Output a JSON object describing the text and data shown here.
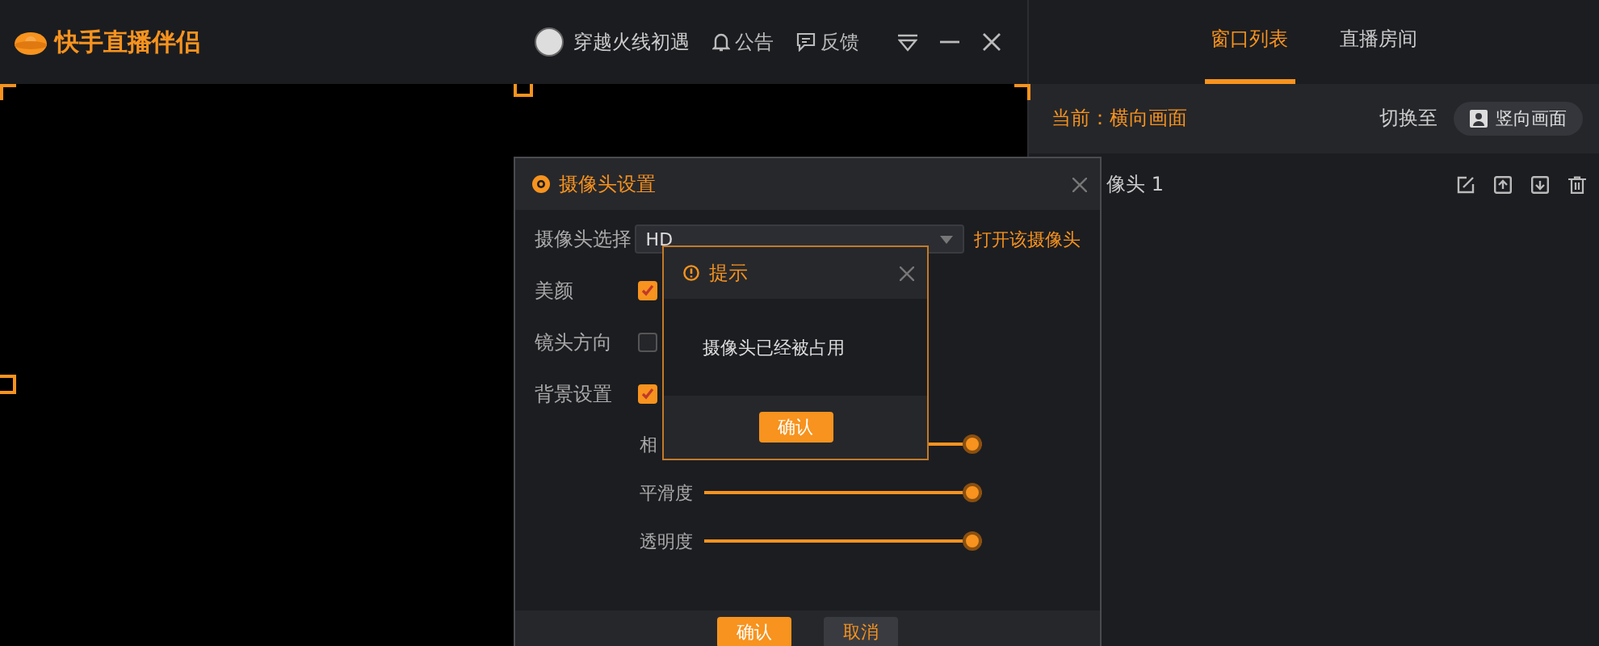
{
  "app": {
    "title": "快手直播伴侣"
  },
  "user": {
    "name": "穿越火线初遇"
  },
  "top_actions": [
    {
      "kind": "notice",
      "label": "公告"
    },
    {
      "kind": "feedback",
      "label": "反馈"
    }
  ],
  "right_panel": {
    "tabs": [
      {
        "label": "窗口列表",
        "selected": true
      },
      {
        "label": "直播房间",
        "selected": false
      }
    ],
    "current": "当前：横向画面",
    "switch_label": "切换至",
    "switch_button": "竖向画面",
    "sources": [
      {
        "name": "像头 1"
      }
    ]
  },
  "camera_dialog": {
    "title": "摄像头设置",
    "rows": [
      {
        "kind": "select",
        "label": "摄像头选择",
        "value": "HD",
        "link": "打开该摄像头"
      },
      {
        "kind": "checkbox",
        "label": "美颜",
        "checked": true
      },
      {
        "kind": "checkbox",
        "label": "镜头方向",
        "checked": false
      },
      {
        "kind": "checkbox",
        "label": "背景设置",
        "checked": true
      }
    ],
    "sliders": [
      {
        "label": "相",
        "level": 1
      },
      {
        "label": "平滑度",
        "level": 1
      },
      {
        "label": "透明度",
        "level": 1
      }
    ],
    "buttons": [
      {
        "kind": "primary",
        "label": "确认"
      },
      {
        "kind": "secondary",
        "label": "取消"
      }
    ]
  },
  "alert": {
    "title": "提示",
    "message": "摄像头已经被占用",
    "button": "确认"
  }
}
